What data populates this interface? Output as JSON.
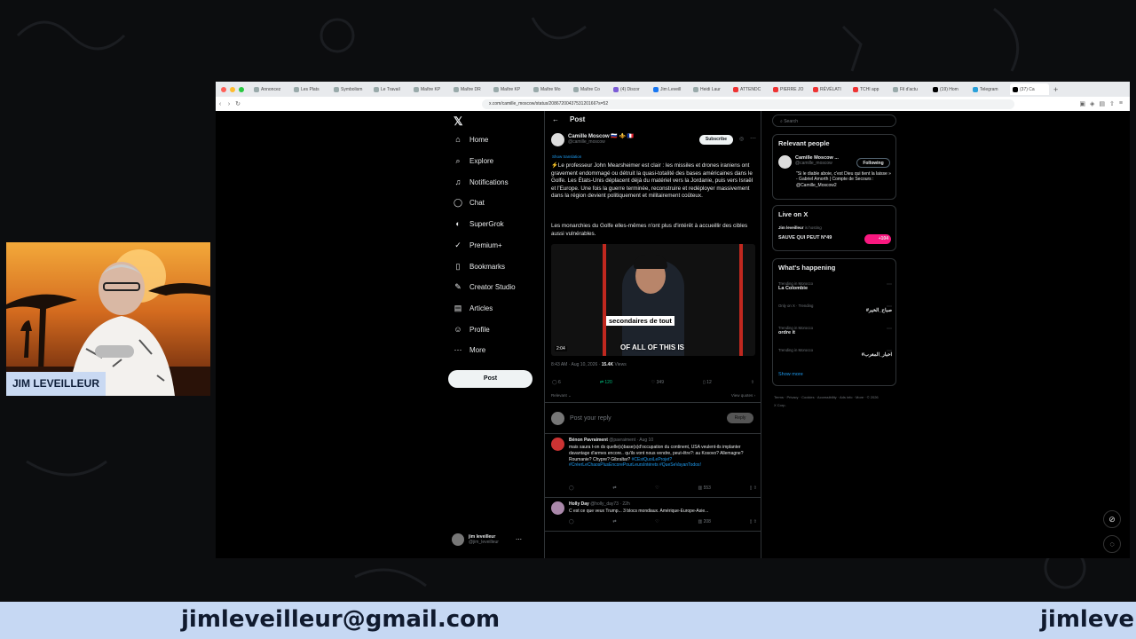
{
  "browser": {
    "tabs": [
      "Annoncez",
      "Les Plats",
      "Symbolism",
      "Le Travail",
      "Maître KP",
      "Maître DR",
      "Maître KP",
      "Maître Mo",
      "Maître Co",
      "(4) Discor",
      "Jim Leveill",
      "Heidi Laur",
      "ATTENDC",
      "PIERRE JO",
      "RÉVÉLATI",
      "TCHI app",
      "Fil d'actu",
      "(19) Hom",
      "Telegram",
      "(37) Ca"
    ],
    "url": "x.com/camille_moscow/status/2086720043753120166?s=52"
  },
  "nav": {
    "items": [
      {
        "icon": "home-icon",
        "label": "Home"
      },
      {
        "icon": "search-icon",
        "label": "Explore"
      },
      {
        "icon": "bell-icon",
        "label": "Notifications"
      },
      {
        "icon": "chat-icon",
        "label": "Chat"
      },
      {
        "icon": "grok-icon",
        "label": "SuperGrok"
      },
      {
        "icon": "premium-icon",
        "label": "Premium+"
      },
      {
        "icon": "bookmark-icon",
        "label": "Bookmarks"
      },
      {
        "icon": "creator-icon",
        "label": "Creator Studio"
      },
      {
        "icon": "articles-icon",
        "label": "Articles"
      },
      {
        "icon": "profile-icon",
        "label": "Profile"
      },
      {
        "icon": "more-icon",
        "label": "More"
      }
    ],
    "notif_badge": "20+",
    "post_button": "Post",
    "account_name": "jim leveilleur",
    "account_handle": "@jim_leveilleur"
  },
  "post": {
    "header": "Post",
    "author_name": "Camille Moscow 🇷🇺 ⚜️ 🇫🇷",
    "author_handle": "@camille_moscow",
    "subscribe": "Subscribe",
    "show_translation": "Show translation",
    "text1": "⚡Le professeur John Mearsheimer est clair : les missiles et drones iraniens ont gravement endommagé ou détruit la quasi-totalité des bases américaines dans le Golfe. Les États-Unis déplacent déjà du matériel vers la Jordanie, puis vers Israël et l'Europe. Une fois la guerre terminée, reconstruire et redéployer massivement dans la région devient politiquement et militairement coûteux.",
    "text2": "Les monarchies du Golfe elles-mêmes n'ont plus d'intérêt à accueillir des cibles aussi vulnérables.",
    "video_caption1": "secondaires de tout",
    "video_caption2": "OF ALL OF THIS IS",
    "video_time": "2:04",
    "meta_time": "8:43 AM · Aug 10, 2026 · ",
    "views": "15.4K",
    "views_label": " Views",
    "replies": "6",
    "reposts": "120",
    "likes": "349",
    "bookmarks": "12",
    "relevant": "Relevant ⌄",
    "view_quotes": "View quotes ›",
    "reply_placeholder": "Post your reply",
    "reply_button": "Reply"
  },
  "comments": [
    {
      "name": "Bénon Pavraiment",
      "meta": "@pavraiment · Aug 10",
      "text": "mais saura t-on ds quelle(s)base(s)d'occupation du continent, USA veulent-ils implanter davantage d'armes encore.. qu'ils vont nous vendre, peut-être?: au Kosovo? Allemagne? Roumanie? Chypre? Gibraltar?",
      "tags": "#CEstQuoiLeProjet? #CréerLeChaosPlusEncorePourLeursIntérets #QueSeVayanTodos!",
      "views": "553"
    },
    {
      "name": "Holly Day",
      "meta": "@holly_day73 · 22h",
      "text": "C est ce que veux Trump... 3 blocs mondiaux. Amérique-Europe-Asie...",
      "tags": "",
      "views": "208"
    }
  ],
  "sidebar": {
    "search_placeholder": "Search",
    "relevant_title": "Relevant people",
    "rp_name": "Camille Moscow ...",
    "rp_handle": "@camille_moscow",
    "follow": "Following",
    "rp_bio": "\"Si le diable aboie, c'est Dieu qui tient la laisse » - Gabriel Amorth | Compte de Secours : @Camille_Moscow2",
    "live_title": "Live on X",
    "live_host": "Jim leveilleur",
    "live_status": "is hosting",
    "live_name": "SAUVE QUI PEUT N°49",
    "live_count": "+104",
    "happening_title": "What's happening",
    "trends": [
      {
        "ctx": "Trending in Morocco",
        "name": "La Colombie"
      },
      {
        "ctx": "Only on X · Trending",
        "name": "#صباح_الخير"
      },
      {
        "ctx": "Trending in Morocco",
        "name": "ordre it"
      },
      {
        "ctx": "Trending in Morocco",
        "name": "#اخبار_المغرب"
      }
    ],
    "show_more": "Show more",
    "footer": "Terms · Privacy · Cookies · Accessibility · Ads info · More · © 2026 X Corp."
  },
  "webcam": {
    "name": "JIM LEVEILLEUR"
  },
  "banner": {
    "email": "jimleveilleur@gmail.com",
    "email_cut": "jimleveil"
  },
  "colors": {
    "accent": "#1d9bf0",
    "banner": "#c6d8f3"
  }
}
